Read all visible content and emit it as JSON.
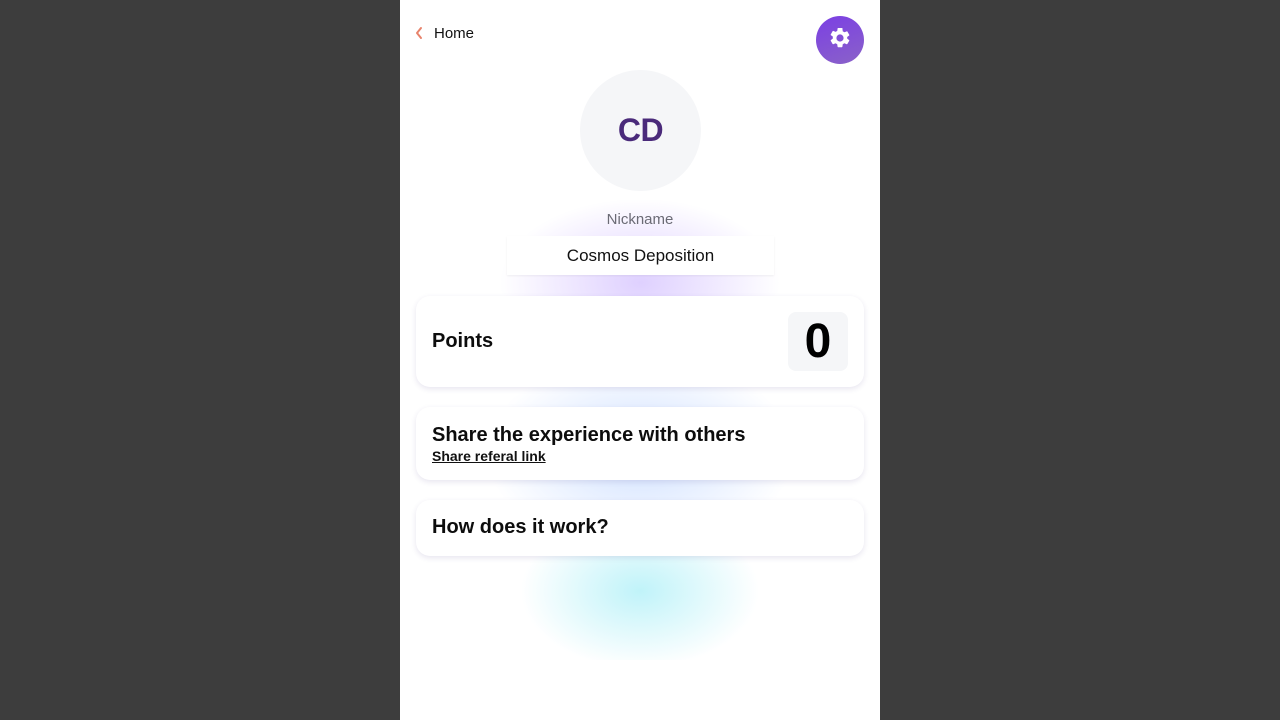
{
  "nav": {
    "back_label": "Home",
    "back_icon": "chevron-left-icon",
    "settings_icon": "gear-icon"
  },
  "profile": {
    "initials": "CD",
    "nickname_label": "Nickname",
    "nickname_value": "Cosmos Deposition"
  },
  "points": {
    "label": "Points",
    "value": "0"
  },
  "share": {
    "title": "Share the experience with others",
    "link_label": "Share referal link"
  },
  "how": {
    "title": "How does it work?"
  },
  "colors": {
    "accent": "#7b3fe4",
    "back_chevron": "#e8836b",
    "initials": "#4a2a7a",
    "outer_background": "#3d3d3d"
  }
}
